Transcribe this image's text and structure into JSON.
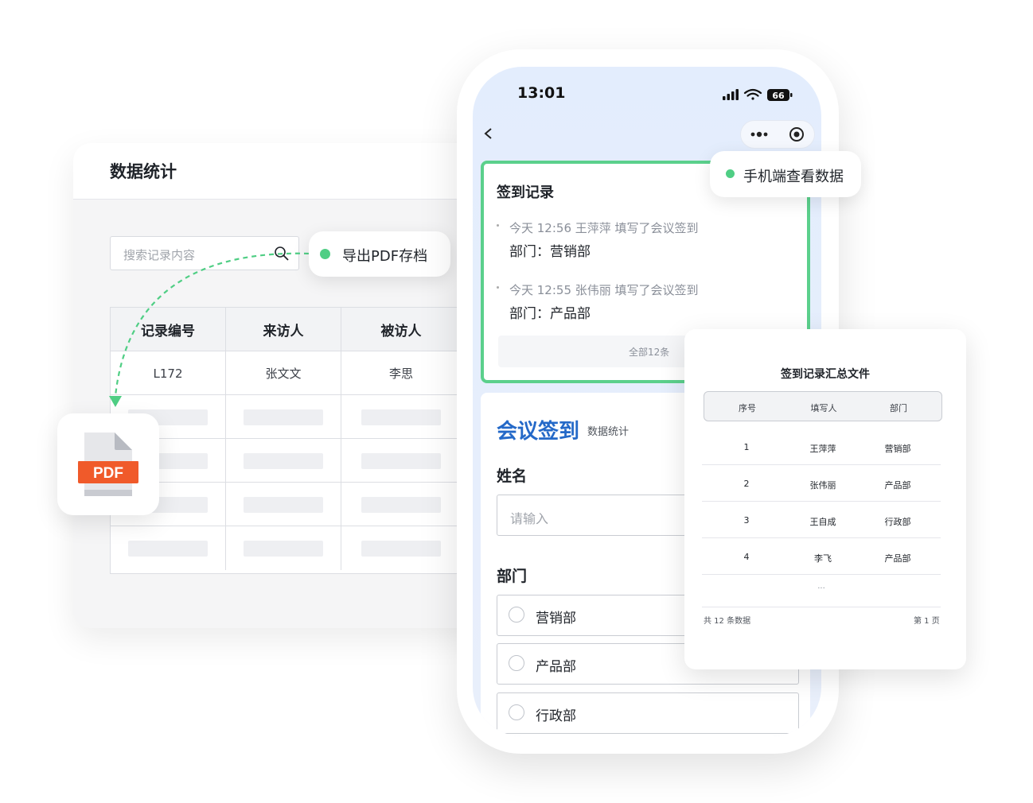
{
  "desktop": {
    "title": "数据统计",
    "search_placeholder": "搜索记录内容",
    "table": {
      "headers": [
        "记录编号",
        "来访人",
        "被访人"
      ],
      "rows": [
        [
          "L172",
          "张文文",
          "李思"
        ]
      ],
      "placeholder_rows": 4
    }
  },
  "export_chip": {
    "label": "导出PDF存档"
  },
  "pdf_icon": {
    "label": "PDF",
    "color": "#f05a2a"
  },
  "phone": {
    "time": "13:01",
    "battery": "66",
    "records": {
      "title": "签到记录",
      "items": [
        {
          "line1": "今天 12:56 王萍萍  填写了会议签到",
          "line2": "部门：营销部"
        },
        {
          "line1": "今天 12:55 张伟丽  填写了会议签到",
          "line2": "部门：产品部"
        }
      ],
      "all_link": "全部12条"
    },
    "form": {
      "title": "会议签到",
      "subtitle": "数据统计",
      "name_label": "姓名",
      "name_placeholder": "请输入",
      "dept_label": "部门",
      "dept_options": [
        "营销部",
        "产品部",
        "行政部"
      ]
    }
  },
  "mobile_chip": {
    "label": "手机端查看数据"
  },
  "summary_doc": {
    "title": "签到记录汇总文件",
    "headers": [
      "序号",
      "填写人",
      "部门"
    ],
    "rows": [
      [
        "1",
        "王萍萍",
        "营销部"
      ],
      [
        "2",
        "张伟丽",
        "产品部"
      ],
      [
        "3",
        "王自成",
        "行政部"
      ],
      [
        "4",
        "李飞",
        "产品部"
      ]
    ],
    "ellipsis": "...",
    "footer_left": "共 12 条数据",
    "footer_right": "第 1 页"
  },
  "colors": {
    "accent_green": "#4fce84",
    "brand_blue": "#2469c8",
    "pdf_red": "#f05a2a"
  }
}
